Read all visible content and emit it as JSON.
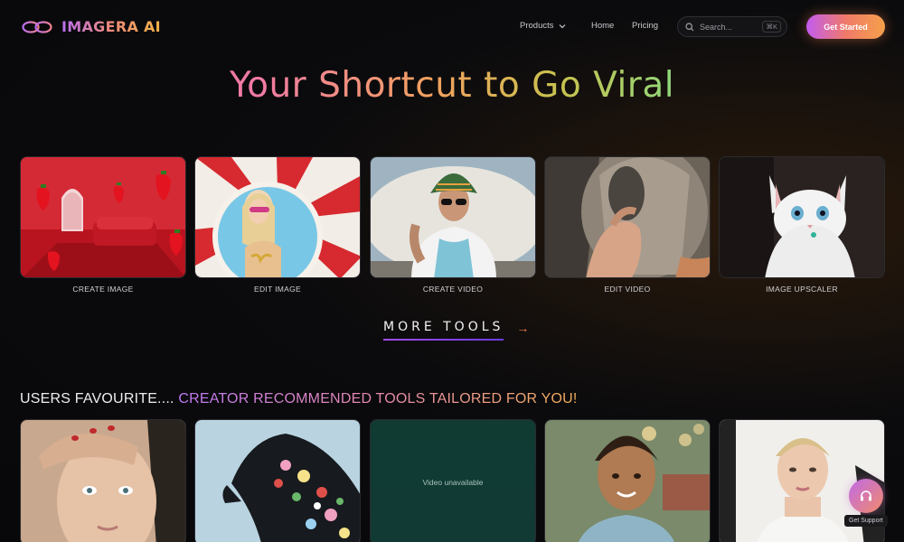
{
  "brand": {
    "name": "IMAGERA AI",
    "logo_icon": "infinity-rings-icon"
  },
  "nav": {
    "products": "Products",
    "home": "Home",
    "pricing": "Pricing",
    "search_placeholder": "Search...",
    "search_shortcut": "⌘K",
    "cta": "Get Started"
  },
  "hero": {
    "title": "Your Shortcut to Go Viral"
  },
  "tools": [
    {
      "label": "CREATE IMAGE",
      "thumb": "strawberry-room-image"
    },
    {
      "label": "EDIT IMAGE",
      "thumb": "woman-pool-float-image"
    },
    {
      "label": "CREATE VIDEO",
      "thumb": "man-bucket-hat-image"
    },
    {
      "label": "EDIT VIDEO",
      "thumb": "hand-hat-image"
    },
    {
      "label": "IMAGE UPSCALER",
      "thumb": "white-kitten-image"
    }
  ],
  "more_tools": {
    "label": "MORE TOOLS",
    "icon": "arrow-right-icon"
  },
  "favourites": {
    "title_a": "USERS FAVOURITE....",
    "title_b": "CREATOR RECOMMENDED TOOLS TAILORED FOR YOU!",
    "video_unavailable": "Video unavailable"
  },
  "support": {
    "label": "Get Support",
    "icon": "headset-icon"
  },
  "colors": {
    "background": "#08080a",
    "accent_purple": "#c25cf0",
    "accent_orange": "#f5a04a",
    "accent_pink": "#f07aa6"
  }
}
